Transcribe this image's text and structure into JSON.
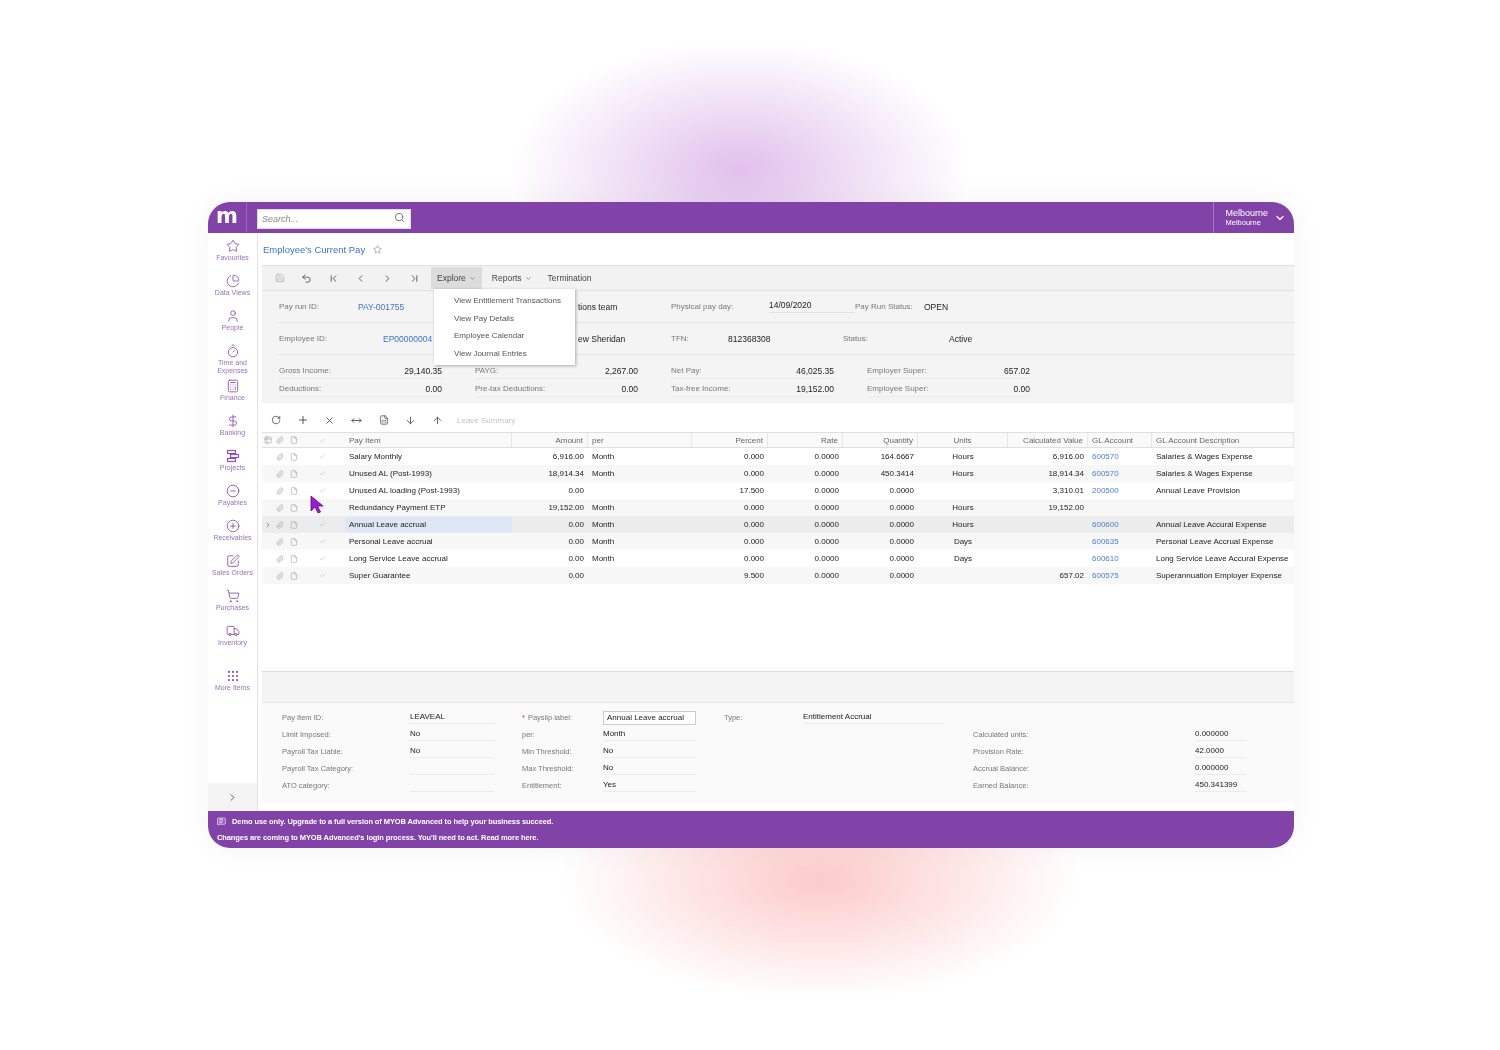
{
  "top_bar": {
    "logo": "m",
    "search": {
      "placeholder": "Search..."
    },
    "branch": {
      "line_1": "Melbourne",
      "line_2": "Melbourne"
    }
  },
  "sidebar": {
    "items": [
      {
        "label": "Favourites",
        "kind": "star"
      },
      {
        "label": "Data Views",
        "kind": "pie"
      },
      {
        "label": "People",
        "kind": "person"
      },
      {
        "label": "Time and Expenses",
        "kind": "timer"
      },
      {
        "label": "Finance",
        "kind": "calculator"
      },
      {
        "label": "Banking",
        "kind": "dollar"
      },
      {
        "label": "Projects",
        "kind": "projects"
      },
      {
        "label": "Payables",
        "kind": "minus"
      },
      {
        "label": "Receivables",
        "kind": "plus"
      },
      {
        "label": "Sales Orders",
        "kind": "pen"
      },
      {
        "label": "Purchases",
        "kind": "cart"
      },
      {
        "label": "Inventory",
        "kind": "truck"
      }
    ],
    "more": {
      "label": "More Items"
    }
  },
  "page_title": "Employee's Current Pay",
  "toolbar": {
    "menus": [
      {
        "label": "Explore",
        "has_menu": true,
        "open": true
      },
      {
        "label": "Reports",
        "has_menu": true,
        "open": false
      },
      {
        "label": "Termination",
        "has_menu": false,
        "open": false
      }
    ],
    "explore_menu": [
      "View Entitlement Transactions",
      "View Pay Details",
      "Employee Calendar",
      "View Journal Entries"
    ]
  },
  "form": {
    "rows": [
      [
        {
          "kind": "label",
          "text": "Pay run ID:"
        },
        {
          "kind": "link",
          "text": "PAY-001755"
        },
        {
          "kind": "value",
          "text": "tions team"
        },
        {
          "kind": "label",
          "text": "Physical pay day:"
        },
        {
          "kind": "field",
          "text": "14/09/2020"
        },
        {
          "kind": "label",
          "text": "Pay Run Status:"
        },
        {
          "kind": "value",
          "text": "OPEN"
        }
      ],
      [
        {
          "kind": "label",
          "text": "Employee ID:"
        },
        {
          "kind": "link",
          "text": "EP00000004"
        },
        {
          "kind": "value",
          "text": "ew Sheridan"
        },
        {
          "kind": "label",
          "text": "TFN:"
        },
        {
          "kind": "value",
          "text": "812368308"
        },
        {
          "kind": "label",
          "text": "Status:"
        },
        {
          "kind": "value",
          "text": "Active"
        }
      ]
    ],
    "summary": [
      {
        "label": "Gross Income:",
        "value": "29,140.35"
      },
      {
        "label": "PAYG:",
        "value": "2,267.00"
      },
      {
        "label": "Net Pay:",
        "value": "46,025.35"
      },
      {
        "label": "Employer Super:",
        "value": "657.02"
      },
      {
        "label": "Deductions:",
        "value": "0.00"
      },
      {
        "label": "Pre-tax Deductions:",
        "value": "0.00"
      },
      {
        "label": "Tax-free Income:",
        "value": "19,152.00"
      },
      {
        "label": "Employee Super:",
        "value": "0.00"
      }
    ]
  },
  "grid_toolbar": {
    "leave_summary": {
      "label": "Leave Summary",
      "disabled": true
    }
  },
  "table": {
    "columns": [
      "Pay Item",
      "Amount",
      "per",
      "Percent",
      "Rate",
      "Quantity",
      "Units",
      "Calculated Value",
      "GL Account",
      "GL Account Description"
    ],
    "rows": [
      {
        "selected": false,
        "cells": [
          "Salary Monthly",
          "6,916.00",
          "Month",
          "0.000",
          "0.0000",
          "164.6667",
          "Hours",
          "6,916.00",
          "600570",
          "Salaries & Wages Expense"
        ]
      },
      {
        "selected": false,
        "cells": [
          "Unused AL (Post-1993)",
          "18,914.34",
          "Month",
          "0.000",
          "0.0000",
          "450.3414",
          "Hours",
          "18,914.34",
          "600570",
          "Salaries & Wages Expense"
        ]
      },
      {
        "selected": false,
        "cells": [
          "Unused AL loading (Post-1993)",
          "0.00",
          null,
          "17.500",
          "0.0000",
          "0.0000",
          null,
          "3,310.01",
          "200500",
          "Annual Leave Provision"
        ]
      },
      {
        "selected": false,
        "cells": [
          "Redundancy Payment ETP",
          "19,152.00",
          "Month",
          "0.000",
          "0.0000",
          "0.0000",
          "Hours",
          "19,152.00",
          null,
          null
        ]
      },
      {
        "selected": true,
        "cells": [
          "Annual Leave accrual",
          "0.00",
          "Month",
          "0.000",
          "0.0000",
          "0.0000",
          "Hours",
          null,
          "600600",
          "Annual Leave Accural Expense"
        ]
      },
      {
        "selected": false,
        "cells": [
          "Personal Leave accrual",
          "0.00",
          "Month",
          "0.000",
          "0.0000",
          "0.0000",
          "Days",
          null,
          "600635",
          "Personal Leave Accrual Expense"
        ]
      },
      {
        "selected": false,
        "cells": [
          "Long Service Leave accrual",
          "0.00",
          "Month",
          "0.000",
          "0.0000",
          "0.0000",
          "Days",
          null,
          "600610",
          "Long Service Leave Accural Expense"
        ]
      },
      {
        "selected": false,
        "cells": [
          "Super Guarantee",
          "0.00",
          null,
          "9.500",
          "0.0000",
          "0.0000",
          null,
          "657.02",
          "600575",
          "Superannuation Employer Expense"
        ]
      }
    ]
  },
  "detail": {
    "columns": [
      [
        {
          "label": "Pay Item ID:",
          "value": "LEAVEAL"
        },
        {
          "label": "Limit Imposed:",
          "value": "No"
        },
        {
          "label": "Payroll Tax Liable:",
          "value": "No"
        },
        {
          "label": "Payroll Tax Category:"
        },
        {
          "label": "ATO category:"
        }
      ],
      [
        {
          "label": "Payslip label:",
          "value": "Annual Leave accrual",
          "required_mark": "*",
          "kind": "input"
        },
        {
          "label": "per:",
          "value": "Month"
        },
        {
          "label": "Min Threshold:",
          "value": "No"
        },
        {
          "label": "Max Threshold:",
          "value": "No"
        },
        {
          "label": "Entitlement:",
          "value": "Yes"
        }
      ],
      [
        {
          "label": "Type:",
          "value": "Entitlement Accrual"
        }
      ],
      [
        {
          "label": "Calculated units:",
          "value": "0.000000"
        },
        {
          "label": "Provision Rate:",
          "value": "42.0000"
        },
        {
          "label": "Accrual Balance:",
          "value": "0.000000"
        },
        {
          "label": "Earned Balance:",
          "value": "450.341399"
        }
      ]
    ]
  },
  "banner": {
    "lines": [
      "Demo use only. Upgrade to a full version of MYOB Advanced to help your business succeed.",
      "Changes are coming to MYOB Advanced's login process. You'll need to act. Read more here."
    ]
  }
}
